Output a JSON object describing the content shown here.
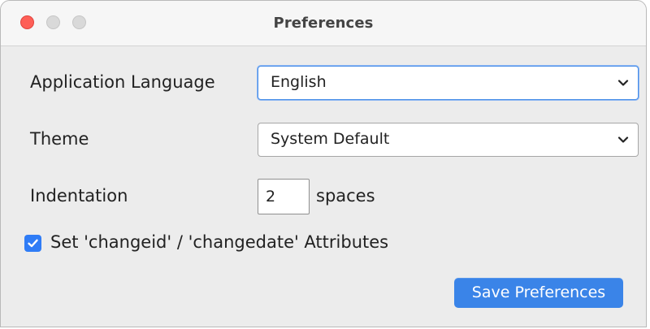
{
  "window": {
    "title": "Preferences",
    "controls": {
      "close": "close-icon",
      "minimize": "minimize-icon",
      "zoom": "zoom-icon"
    }
  },
  "form": {
    "language": {
      "label": "Application Language",
      "selected": "English"
    },
    "theme": {
      "label": "Theme",
      "selected": "System Default"
    },
    "indentation": {
      "label": "Indentation",
      "value": "2",
      "unit": "spaces"
    },
    "change_attributes": {
      "checked": true,
      "label": "Set 'changeid' / 'changedate' Attributes"
    },
    "save_label": "Save Preferences"
  },
  "colors": {
    "accent": "#3a84e8",
    "checkbox": "#2f7cf6",
    "close_button": "#fe5f57",
    "focus_ring": "#4a8fe8"
  }
}
